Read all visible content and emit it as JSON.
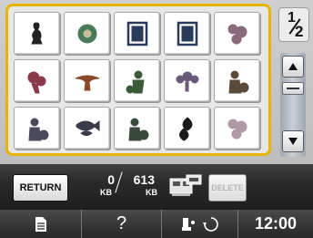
{
  "pager": {
    "current": "1",
    "total": "2"
  },
  "designs": [
    {
      "icon": "figure-silhouette-icon",
      "color": "#222222"
    },
    {
      "icon": "round-ornament-icon",
      "color": "#4a7a58"
    },
    {
      "icon": "framed-picture-icon",
      "color": "#2a3a5a"
    },
    {
      "icon": "framed-picture-icon",
      "color": "#2a3a5a"
    },
    {
      "icon": "flowers-icon",
      "color": "#8a6a7a"
    },
    {
      "icon": "bouquet-icon",
      "color": "#8a3a4a"
    },
    {
      "icon": "bird-wings-icon",
      "color": "#8a4a2a"
    },
    {
      "icon": "child-scene-icon",
      "color": "#3a5a3a"
    },
    {
      "icon": "floral-spray-icon",
      "color": "#6a5a7a"
    },
    {
      "icon": "figure-scene-icon",
      "color": "#5a4a3a"
    },
    {
      "icon": "figure-scene-icon",
      "color": "#4a4a5a"
    },
    {
      "icon": "fish-icon",
      "color": "#3a3a4a"
    },
    {
      "icon": "figure-scene-icon",
      "color": "#3a4a3a"
    },
    {
      "icon": "leaf-icon",
      "color": "#1a1a1a"
    },
    {
      "icon": "flowers-icon",
      "color": "#b09aa6"
    }
  ],
  "toolbar": {
    "return_label": "RETURN",
    "used": "0",
    "used_unit": "KB",
    "total": "613",
    "total_unit": "KB",
    "delete_label": "DELETE"
  },
  "statusbar": {
    "clock": "12:00",
    "help_label": "?"
  },
  "colors": {
    "accent": "#e8b400",
    "bar": "#262626"
  }
}
